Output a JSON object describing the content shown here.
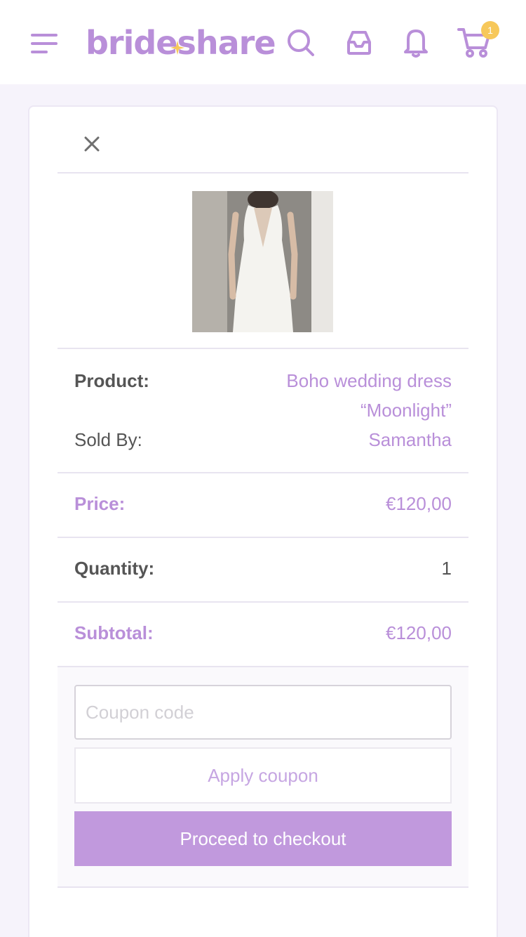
{
  "header": {
    "logo_text": "brideshare",
    "cart_count": "1",
    "icons": {
      "menu": "hamburger-menu-icon",
      "search": "search-icon",
      "inbox": "inbox-icon",
      "notifications": "bell-icon",
      "cart": "cart-icon"
    }
  },
  "cart_item": {
    "close_icon": "close-icon",
    "image_alt": "white wedding dress photo",
    "product_label": "Product:",
    "product_name_line1": "Boho wedding dress",
    "product_name_line2": "“Moonlight”",
    "sold_by_label": "Sold By:",
    "seller": "Samantha",
    "price_label": "Price:",
    "price_value": "€120,00",
    "quantity_label": "Quantity:",
    "quantity_value": "1",
    "subtotal_label": "Subtotal:",
    "subtotal_value": "€120,00"
  },
  "coupon": {
    "placeholder": "Coupon code",
    "value": "",
    "apply_label": "Apply coupon"
  },
  "checkout": {
    "label": "Proceed to checkout"
  },
  "colors": {
    "brand_purple": "#b98fd9",
    "checkout_purple": "#c199dd",
    "badge_yellow": "#f7c85a",
    "page_bg": "#f6f3fb"
  }
}
